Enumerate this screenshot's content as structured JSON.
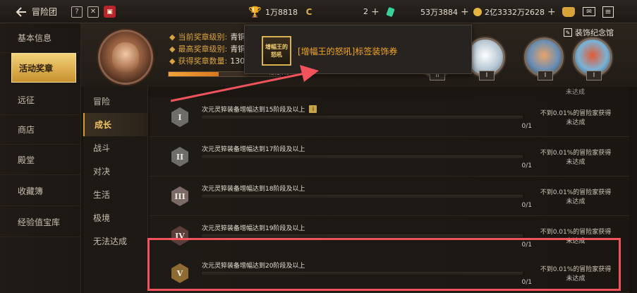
{
  "topbar": {
    "title": "冒险团",
    "trophy_value": "1万8818",
    "c_value": "2",
    "gem_value": "53万3884",
    "gold_value": "2亿3332万2628",
    "plus": "+",
    "c_symbol": "C"
  },
  "sidebar": {
    "items": [
      {
        "label": "基本信息"
      },
      {
        "label": "活动奖章"
      },
      {
        "label": "远征"
      },
      {
        "label": "商店"
      },
      {
        "label": "殿堂"
      },
      {
        "label": "收藏簿"
      },
      {
        "label": "经验值宝库"
      }
    ],
    "active_index": 1
  },
  "header": {
    "rows": [
      {
        "label": "当前奖章级别:",
        "value": "青铜"
      },
      {
        "label": "最高奖章级别:",
        "value": "青铜"
      },
      {
        "label": "获得奖章数量:",
        "value": "130"
      }
    ],
    "progress_text": "45.14%",
    "progress_fraction": 0.4514,
    "decor_label": "装饰纪念馆",
    "medal_tag": "II",
    "medal_tag_2": "I"
  },
  "categories": {
    "items": [
      "冒险",
      "成长",
      "战斗",
      "对决",
      "生活",
      "极境",
      "无法达成"
    ],
    "active_index": 1
  },
  "list": {
    "rows": [
      {
        "tier": "I",
        "title": "次元灵猝装备增幅达到15阶段及以上",
        "has_hint": true,
        "count": "0/1",
        "stat": "不到0.01%的冒险家获得",
        "status": "未达成"
      },
      {
        "tier": "II",
        "title": "次元灵猝装备增幅达到17阶段及以上",
        "has_hint": false,
        "count": "0/1",
        "stat": "不到0.01%的冒险家获得",
        "status": "未达成"
      },
      {
        "tier": "III",
        "title": "次元灵猝装备增幅达到18阶段及以上",
        "has_hint": false,
        "count": "0/1",
        "stat": "不到0.01%的冒险家获得",
        "status": "未达成"
      },
      {
        "tier": "IV",
        "title": "次元灵猝装备增幅达到19阶段及以上",
        "has_hint": false,
        "count": "0/1",
        "stat": "不到0.01%的冒险家获得",
        "status": "未达成"
      },
      {
        "tier": "V",
        "title": "次元灵猝装备增幅达到20阶段及以上",
        "has_hint": false,
        "count": "0/1",
        "stat": "不到0.01%的冒险家获得",
        "status": "未达成"
      }
    ],
    "top_partial_status": "未达成"
  },
  "tooltip": {
    "icon_text": "增幅王的怒吼",
    "text": "[增幅王的怒吼]标签装饰券"
  },
  "colors": {
    "highlight": "#f0535c",
    "accent": "#d8a440"
  }
}
